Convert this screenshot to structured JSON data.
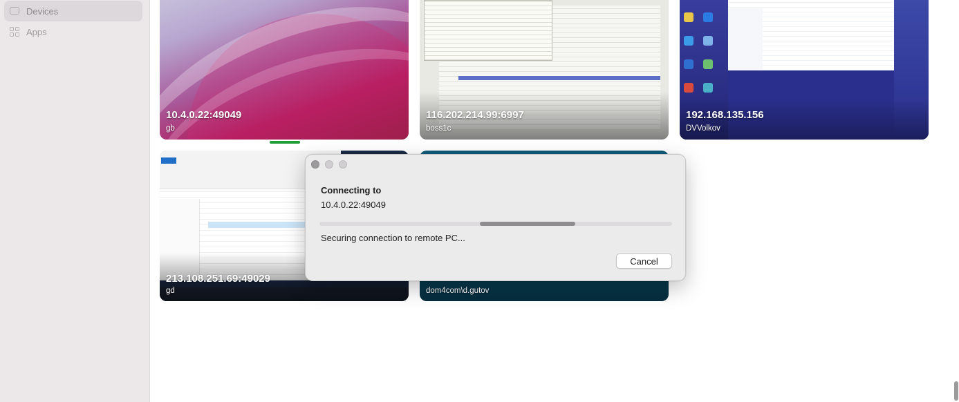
{
  "sidebar": {
    "items": [
      {
        "label": "Devices",
        "icon": "monitor-icon",
        "active": true
      },
      {
        "label": "Apps",
        "icon": "apps-grid-icon",
        "active": false
      }
    ]
  },
  "devices": [
    {
      "address": "10.4.0.22:49049",
      "user": "gb",
      "connecting": true
    },
    {
      "address": "116.202.214.99:6997",
      "user": "boss1c"
    },
    {
      "address": "192.168.135.156",
      "user": "DVVolkov"
    },
    {
      "address": "213.108.251.69:49029",
      "user": "gd"
    },
    {
      "address": "",
      "user": "dom4com\\d.gutov"
    }
  ],
  "dialog": {
    "title": "Connecting to",
    "address": "10.4.0.22:49049",
    "status": "Securing connection to remote PC...",
    "cancel_label": "Cancel",
    "progress_percent": 27
  },
  "colors": {
    "sidebar_bg": "#ece8ea",
    "active_indicator": "#1f9e3a",
    "dialog_bg": "#ecebec"
  }
}
